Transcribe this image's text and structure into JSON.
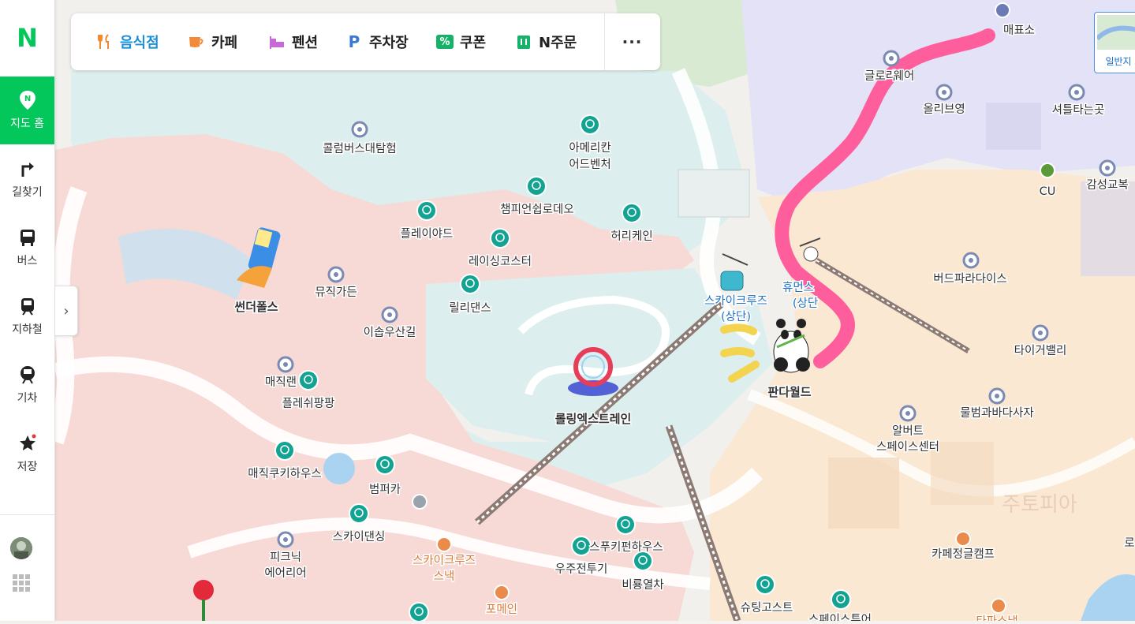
{
  "sidebar": {
    "logo": "N",
    "items": [
      {
        "label": "지도 홈",
        "icon": "map-pin-icon",
        "active": true
      },
      {
        "label": "길찾기",
        "icon": "directions-icon",
        "active": false
      },
      {
        "label": "버스",
        "icon": "bus-icon",
        "active": false
      },
      {
        "label": "지하철",
        "icon": "subway-icon",
        "active": false
      },
      {
        "label": "기차",
        "icon": "train-icon",
        "active": false
      },
      {
        "label": "저장",
        "icon": "star-icon",
        "active": false
      }
    ],
    "collapse_label": "›"
  },
  "categories": {
    "items": [
      {
        "label": "음식점",
        "icon": "restaurant-icon"
      },
      {
        "label": "카페",
        "icon": "cafe-icon"
      },
      {
        "label": "펜션",
        "icon": "pension-icon"
      },
      {
        "label": "주차장",
        "icon": "parking-icon"
      },
      {
        "label": "쿠폰",
        "icon": "coupon-icon"
      },
      {
        "label": "N주문",
        "icon": "order-icon"
      }
    ],
    "more_label": "···",
    "parking_glyph": "P",
    "coupon_glyph": "%"
  },
  "minimap": {
    "label": "일반지"
  },
  "map": {
    "colors": {
      "pink_zone": "#f7d9d6",
      "teal_zone": "#dcefee",
      "purple_zone": "#e3e1f5",
      "sand_zone": "#fbe9d4",
      "green_zone": "#dcecd8",
      "route": "#ff5e9c",
      "attraction_icon": "#12a392",
      "landmark_icon": "#7a8ab3"
    },
    "labels": {
      "ticket_office": "매표소",
      "olive_young": "올리브영",
      "shuttle": "셔틀타는곳",
      "cu": "CU",
      "gamseong": "감성교복",
      "glory": "글로리",
      "glory2": "웨어",
      "column_bus": "콜럼버스대탐험",
      "american1": "아메리칸",
      "american2": "어드벤처",
      "champion": "챔피언쉽로데오",
      "playyard": "플레이야드",
      "hurricane": "허리케인",
      "racing": "레이싱코스터",
      "thunder": "썬더폴스",
      "musical": "뮤직가든",
      "lilly": "릴리댄스",
      "isop": "이솝우산길",
      "skycruise_top1": "스카이크루즈",
      "skycruise_top2": "(상단)",
      "human1": "휴먼스",
      "human2": "(상단",
      "bird": "버드파라다이스",
      "tiger": "타이거밸리",
      "magic_land": "매직랜",
      "flash": "플레쉬팡팡",
      "rolling": "롤링엑스트레인",
      "panda": "판다월드",
      "bumbum": "물범과바다사자",
      "albert1": "알버트",
      "albert2": "스페이스센터",
      "zootopia": "주토피아",
      "magic_cookie": "매직쿠키하우스",
      "bumper": "범퍼카",
      "sky_dancing": "스카이댄싱",
      "picnic1": "피크닉",
      "picnic2": "에어리어",
      "skycruise_boat1": "스카이크루즈",
      "skycruise_boat2": "스낵",
      "spookie": "스푸키펀하우스",
      "space_tour": "우주전투기",
      "dragon": "비룡열차",
      "pomein": "포메인",
      "cafe_jungle": "카페정글캠프",
      "shooting": "슈팅고스트",
      "space_tour2": "스페이스투어",
      "tapa": "타파스냅",
      "ro": "로"
    }
  }
}
